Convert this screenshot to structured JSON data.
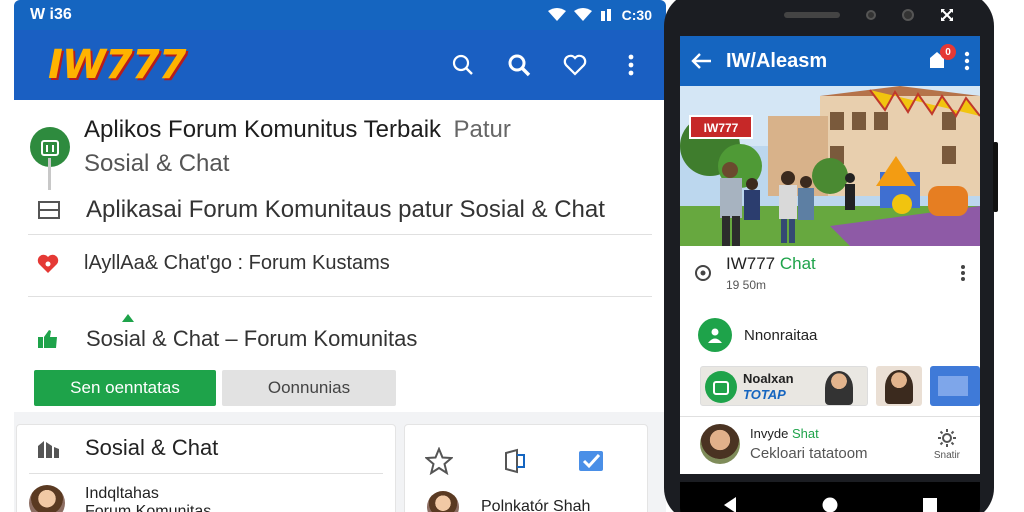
{
  "tablet": {
    "status_bar": {
      "left_text": "W i36",
      "time": "C:30"
    },
    "app_bar": {
      "logo_text": "IW777"
    },
    "rows": {
      "row1_title": "Aplikos Forum Komunitus Terbaik",
      "row1_title_tail": "Patur",
      "row1_sub": "Sosial & Chat",
      "row2_text": "Aplikasai Forum Komunitaus patur Sosial & Chat",
      "row3_text": "lAyllAa& Chat'go  :  Forum Kustams",
      "row4_text": "Sosial & Chat – Forum Komunitas"
    },
    "buttons": {
      "green_label": "Sen oenntatas",
      "grey_label": "Oonnunias"
    },
    "card_a": {
      "title": "Sosial & Chat",
      "user_name": "Indqltahas",
      "user_sub": "Forum Komunitas"
    },
    "card_b": {
      "user_name": "Polnkatór Shah"
    }
  },
  "phone": {
    "app_bar": {
      "title": "IW/Aleasm",
      "badge_count": "0"
    },
    "hero": {
      "sign_text": "IW777"
    },
    "chat_row": {
      "title_prefix": "IW777",
      "title_suffix": "Chat",
      "sub": "19 50m"
    },
    "community_row": {
      "label": "Nnonraitaa"
    },
    "thumb_1": {
      "line1": "Noalxan",
      "line2": "TOTAP"
    },
    "bottom_row": {
      "title_prefix": "Invyde",
      "title_suffix": "Shat",
      "sub": "Cekloari tatatoom",
      "action_label": "Snatir"
    }
  },
  "colors": {
    "primary_blue": "#1a5fc2",
    "accent_green": "#1ea34a",
    "logo_gold": "#ffb300",
    "logo_red": "#b71c1c",
    "badge_red": "#e53935"
  }
}
